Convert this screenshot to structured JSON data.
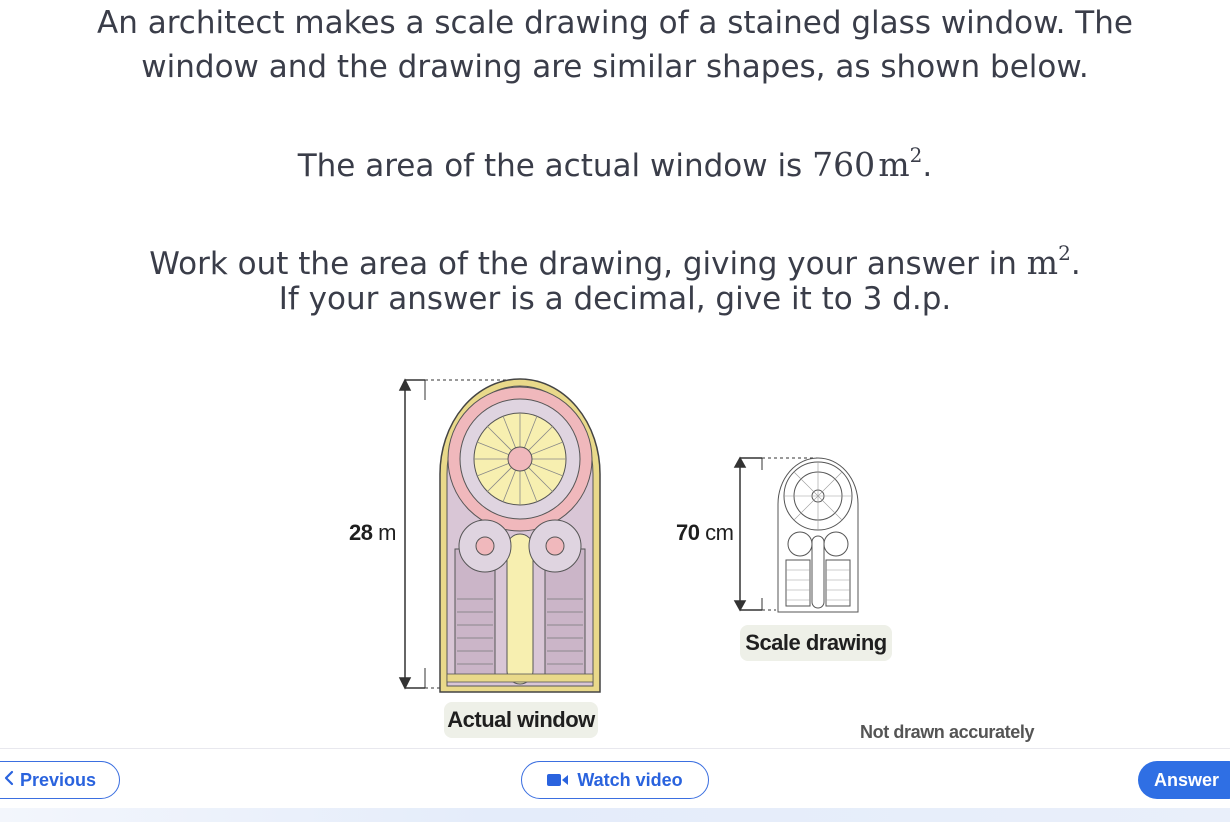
{
  "question": {
    "line1": "An architect makes a scale drawing of a stained glass window. The",
    "line2": "window and the drawing are similar shapes, as shown below.",
    "area_prefix": "The area of the actual window is",
    "area_value": "760",
    "area_unit": "m",
    "area_exp": "2",
    "area_suffix": ".",
    "work_prefix": "Work out the area of the drawing, giving your answer in",
    "work_unit": "m",
    "work_exp": "2",
    "work_suffix": ".",
    "decimal_note": "If your answer is a decimal, give it to 3 d.p."
  },
  "figure": {
    "actual_height_value": "28",
    "actual_height_unit": "m",
    "actual_caption": "Actual window",
    "scale_height_value": "70",
    "scale_height_unit": "cm",
    "scale_caption": "Scale drawing",
    "accuracy_note": "Not drawn accurately"
  },
  "nav": {
    "previous_label": "Previous",
    "watch_label": "Watch video",
    "answer_label": "Answer"
  },
  "colors": {
    "accent": "#2f6fe4",
    "window_frame": "#e9d98a",
    "window_glass": "#d9c6d6"
  }
}
